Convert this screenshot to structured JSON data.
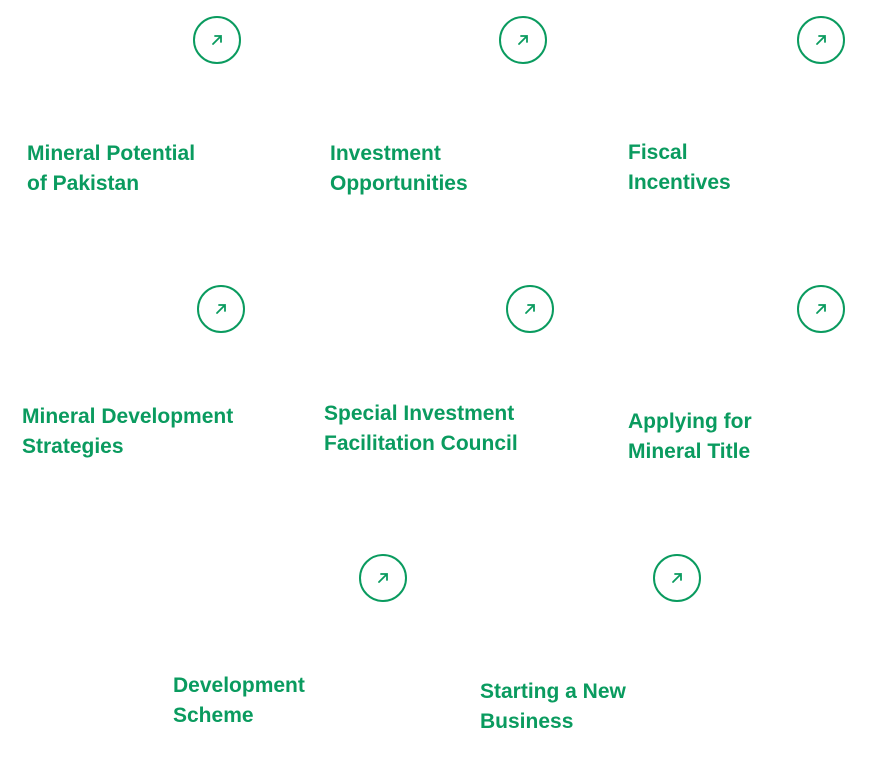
{
  "colors": {
    "accent": "#0a9b5f",
    "background": "#ffffff"
  },
  "cards": [
    {
      "line1": "Mineral Potential",
      "line2": "of Pakistan",
      "icon": "arrow-up-right-icon"
    },
    {
      "line1": "Investment",
      "line2": "Opportunities",
      "icon": "arrow-up-right-icon"
    },
    {
      "line1": "Fiscal",
      "line2": "Incentives",
      "icon": "arrow-up-right-icon"
    },
    {
      "line1": "Mineral Development",
      "line2": "Strategies",
      "icon": "arrow-up-right-icon"
    },
    {
      "line1": "Special Investment",
      "line2": "Facilitation Council",
      "icon": "arrow-up-right-icon"
    },
    {
      "line1": "Applying for",
      "line2": "Mineral Title",
      "icon": "arrow-up-right-icon"
    },
    {
      "line1": "Development",
      "line2": "Scheme",
      "icon": "arrow-up-right-icon"
    },
    {
      "line1": "Starting a New",
      "line2": "Business",
      "icon": "arrow-up-right-icon"
    }
  ]
}
